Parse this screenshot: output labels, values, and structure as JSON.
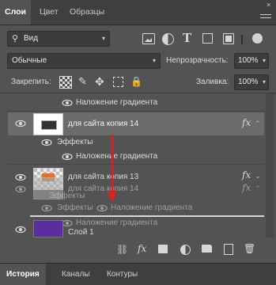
{
  "tabs": [
    {
      "label": "Слои",
      "active": true
    },
    {
      "label": "Цвет",
      "active": false
    },
    {
      "label": "Образцы",
      "active": false
    }
  ],
  "filter": {
    "value": "Вид"
  },
  "blend": {
    "mode": "Обычные",
    "opacity_label": "Непрозрачность:",
    "opacity_value": "100%"
  },
  "lock": {
    "label": "Закрепить:",
    "fill_label": "Заливка:",
    "fill_value": "100%"
  },
  "layers": {
    "effect_top": "Наложение градиента",
    "layer1": {
      "name": "для сайта копия 14",
      "effects_label": "Эффекты",
      "effect": "Наложение градиента"
    },
    "layer2": {
      "name": "для сайта копия 13"
    },
    "ghost": {
      "name": "для сайта копия 14",
      "effects_label": "Эффекты",
      "effect": "Наложение градиента",
      "effect2": "Наложение градиента"
    },
    "layer3": {
      "name": "Слой 1"
    }
  },
  "bottom_tabs": [
    {
      "label": "История",
      "active": true
    },
    {
      "label": "Каналы",
      "active": false
    },
    {
      "label": "Контуры",
      "active": false
    }
  ],
  "fx_glyph": "fx",
  "colors": {
    "accent_drag": "#e02020",
    "layer_color": "#5a2ea0"
  }
}
